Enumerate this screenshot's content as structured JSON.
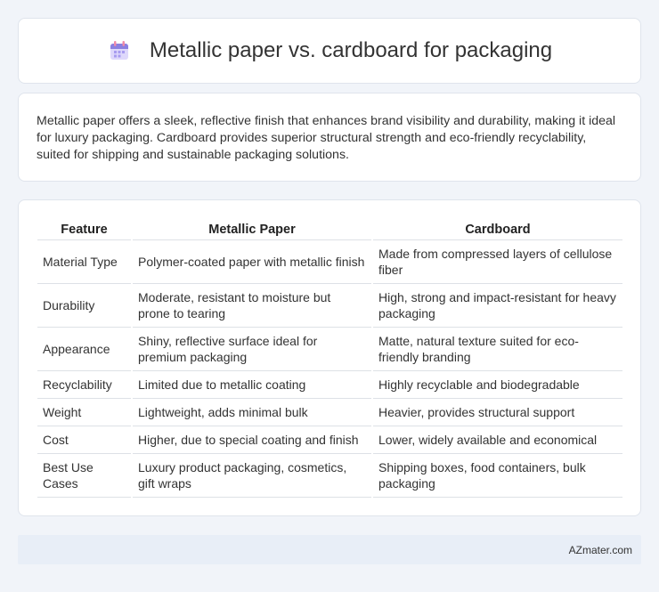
{
  "header": {
    "title": "Metallic paper vs. cardboard for packaging",
    "icon": "calendar-icon"
  },
  "intro": {
    "text": "Metallic paper offers a sleek, reflective finish that enhances brand visibility and durability, making it ideal for luxury packaging. Cardboard provides superior structural strength and eco-friendly recyclability, suited for shipping and sustainable packaging solutions."
  },
  "table": {
    "headers": [
      "Feature",
      "Metallic Paper",
      "Cardboard"
    ],
    "rows": [
      [
        "Material Type",
        "Polymer-coated paper with metallic finish",
        "Made from compressed layers of cellulose fiber"
      ],
      [
        "Durability",
        "Moderate, resistant to moisture but prone to tearing",
        "High, strong and impact-resistant for heavy packaging"
      ],
      [
        "Appearance",
        "Shiny, reflective surface ideal for premium packaging",
        "Matte, natural texture suited for eco-friendly branding"
      ],
      [
        "Recyclability",
        "Limited due to metallic coating",
        "Highly recyclable and biodegradable"
      ],
      [
        "Weight",
        "Lightweight, adds minimal bulk",
        "Heavier, provides structural support"
      ],
      [
        "Cost",
        "Higher, due to special coating and finish",
        "Lower, widely available and economical"
      ],
      [
        "Best Use Cases",
        "Luxury product packaging, cosmetics, gift wraps",
        "Shipping boxes, food containers, bulk packaging"
      ]
    ]
  },
  "footer": {
    "text": "AZmater.com"
  },
  "colors": {
    "background": "#f1f4f9",
    "card": "#ffffff",
    "footer": "#e8eef7",
    "icon_primary": "#8b7fe0",
    "icon_accent": "#f08aa8"
  }
}
